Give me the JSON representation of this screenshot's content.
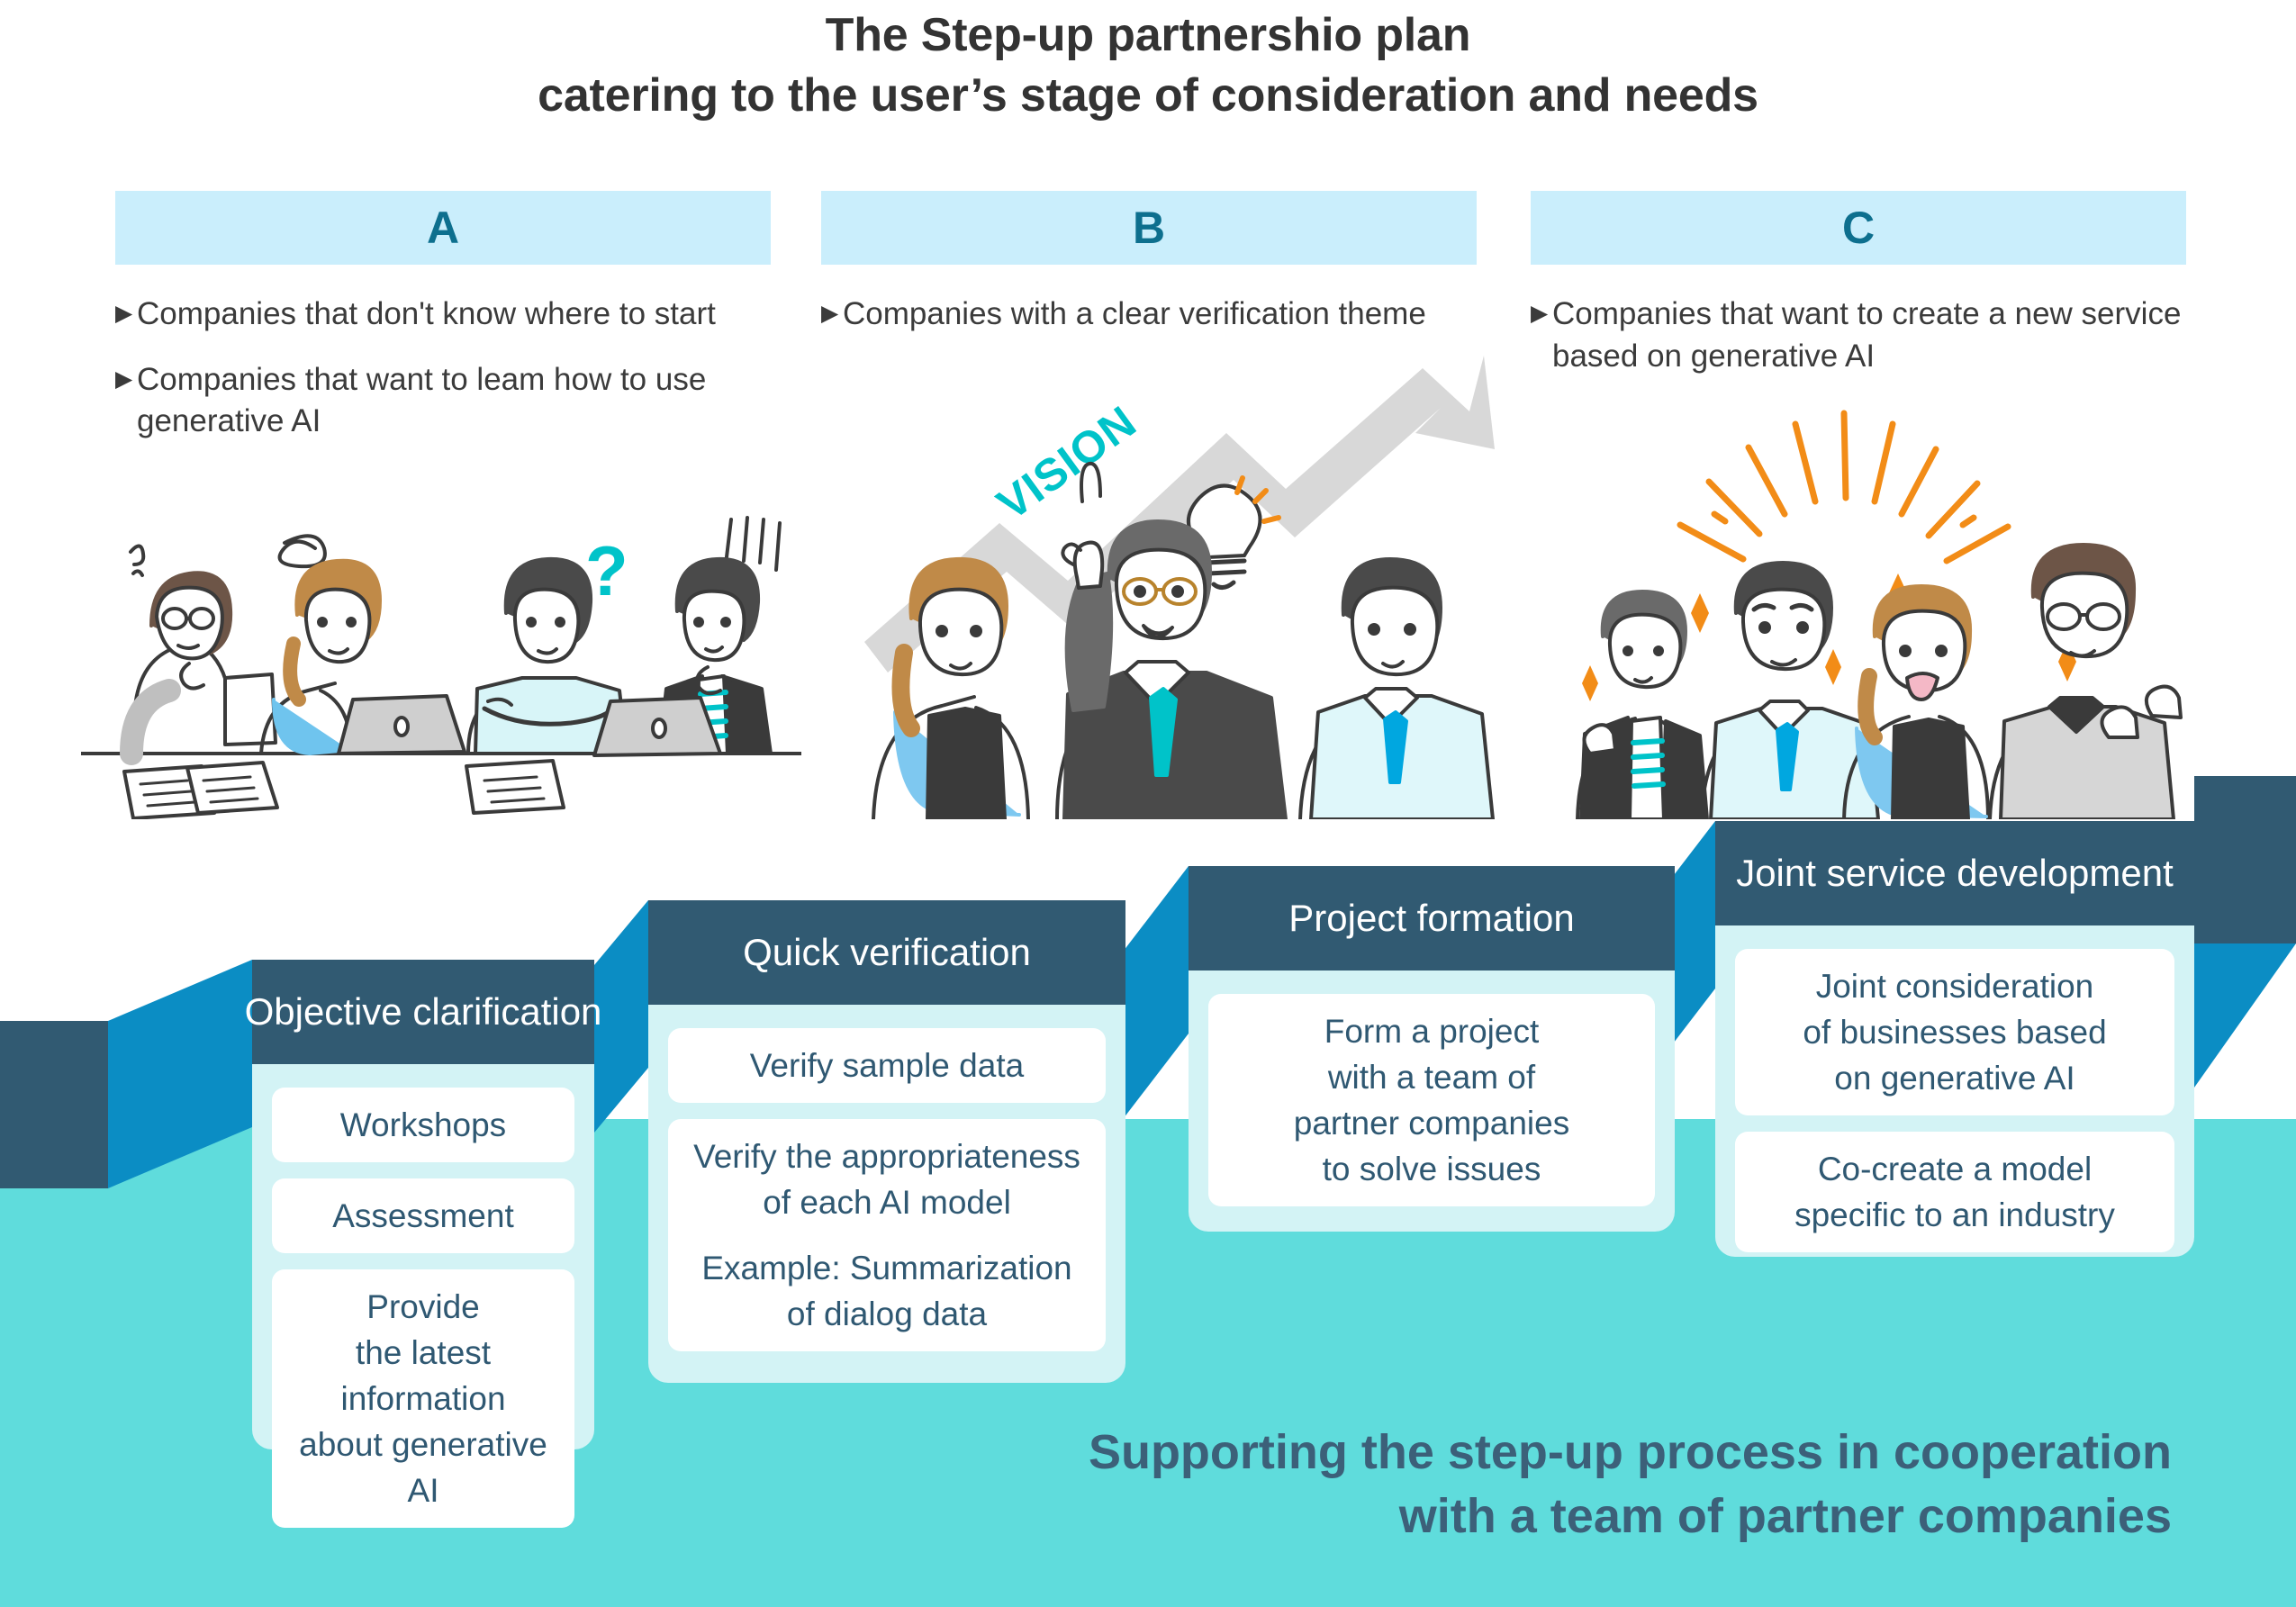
{
  "title": {
    "line1": "The Step-up partnershio plan",
    "line2": "catering to the user’s stage of consideration and needs"
  },
  "colors": {
    "column_header_bg": "#caeefc",
    "column_header_text": "#0d6f8e",
    "step_header_bg": "#315a72",
    "step_riser_blue": "#0b8dc4",
    "step_body_bg": "#d3f3f5",
    "band_turquoise": "#5fdcdc",
    "accent_cyan": "#00c3c9",
    "accent_orange": "#f28c17",
    "body_text": "#3b3b3b",
    "chip_text": "#2f5872"
  },
  "columns": [
    {
      "label": "A",
      "bullets": [
        "Companies that don't know where to start",
        "Companies that want to leam how to use generative AI"
      ],
      "illustration": "four-confused-people-at-table-icon"
    },
    {
      "label": "B",
      "bullets": [
        "Companies with a clear verification theme"
      ],
      "illustration": "three-people-vision-arrow-icon",
      "arrow_label": "VISION"
    },
    {
      "label": "C",
      "bullets": [
        "Companies that want to create a new service based on generative AI"
      ],
      "illustration": "four-celebrating-people-sparkles-icon"
    }
  ],
  "steps": [
    {
      "header": "Objective clarification",
      "items": [
        {
          "main": "Workshops",
          "sub": ""
        },
        {
          "main": "Assessment",
          "sub": ""
        },
        {
          "main": "Provide\nthe latest information\nabout generative AI",
          "sub": ""
        }
      ]
    },
    {
      "header": "Quick verification",
      "items": [
        {
          "main": "Verify sample data",
          "sub": ""
        },
        {
          "main": "Verify the appropriateness\nof each AI model",
          "sub": "Example: Summarization\nof dialog data"
        }
      ]
    },
    {
      "header": "Project formation",
      "items": [
        {
          "main": "Form a project\nwith a team of\npartner companies\nto solve issues",
          "sub": ""
        }
      ]
    },
    {
      "header": "Joint service development",
      "items": [
        {
          "main": "Joint consideration\nof businesses based\non generative AI",
          "sub": ""
        },
        {
          "main": "Co-create a model\nspecific to an industry",
          "sub": ""
        }
      ]
    }
  ],
  "tagline": {
    "line1": "Supporting the step-up process in cooperation",
    "line2": "with a team of partner companies"
  }
}
